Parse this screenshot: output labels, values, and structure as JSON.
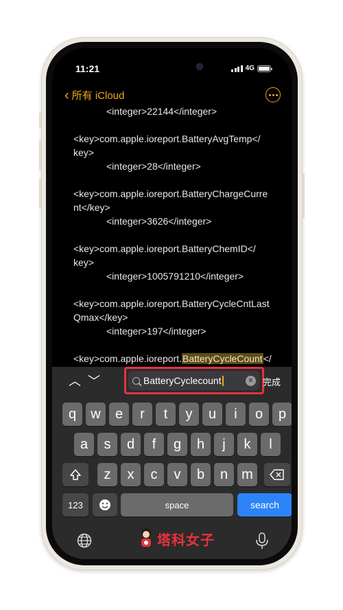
{
  "status": {
    "time": "11:21",
    "network": "4G"
  },
  "nav": {
    "back_label": "所有 iCloud"
  },
  "note_lines": [
    {
      "text": "<integer>22144</integer>",
      "indent": true
    },
    {
      "gap": true
    },
    {
      "text": "<key>com.apple.ioreport.BatteryAvgTemp</",
      "indent": false
    },
    {
      "text": "key>",
      "indent": false
    },
    {
      "text": "<integer>28</integer>",
      "indent": true
    },
    {
      "gap": true
    },
    {
      "text": "<key>com.apple.ioreport.BatteryChargeCurre",
      "indent": false
    },
    {
      "text": "nt</key>",
      "indent": false
    },
    {
      "text": "<integer>3626</integer>",
      "indent": true
    },
    {
      "gap": true
    },
    {
      "text": "<key>com.apple.ioreport.BatteryChemID</",
      "indent": false
    },
    {
      "text": "key>",
      "indent": false
    },
    {
      "text": "<integer>1005791210</integer>",
      "indent": true
    },
    {
      "gap": true
    },
    {
      "text": "<key>com.apple.ioreport.BatteryCycleCntLast",
      "indent": false
    },
    {
      "text": "Qmax</key>",
      "indent": false
    },
    {
      "text": "<integer>197</integer>",
      "indent": true
    },
    {
      "gap": true
    },
    {
      "text_before": "<key>com.apple.ioreport.",
      "highlight": "BatteryCycleCount",
      "text_after": "</",
      "indent": false
    }
  ],
  "find": {
    "query": "BatteryCyclecount",
    "done_label": "完成"
  },
  "keyboard": {
    "row1": [
      "q",
      "w",
      "e",
      "r",
      "t",
      "y",
      "u",
      "i",
      "o",
      "p"
    ],
    "row2": [
      "a",
      "s",
      "d",
      "f",
      "g",
      "h",
      "j",
      "k",
      "l"
    ],
    "row3": [
      "z",
      "x",
      "c",
      "v",
      "b",
      "n",
      "m"
    ],
    "numbers_label": "123",
    "emoji_icon": "emoji-icon",
    "space_label": "space",
    "search_label": "search"
  },
  "watermark": {
    "text": "塔科女子"
  },
  "colors": {
    "accent": "#f0a81e",
    "search_key": "#2d84f8",
    "highlight_border": "#e8323e"
  }
}
